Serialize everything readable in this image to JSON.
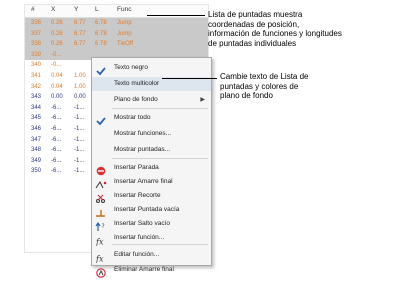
{
  "table": {
    "headers": [
      "#",
      "X",
      "Y",
      "L",
      "Func"
    ],
    "rows": [
      {
        "n": "336",
        "x": "0.26",
        "y": "6.77",
        "l": "6.78",
        "f": "Jump",
        "sel": true,
        "color": "#e07d2e"
      },
      {
        "n": "337",
        "x": "0.26",
        "y": "6.77",
        "l": "6.78",
        "f": "Jump",
        "sel": true,
        "color": "#e07d2e"
      },
      {
        "n": "338",
        "x": "0.26",
        "y": "6.77",
        "l": "6.78",
        "f": "TieOff",
        "sel": true,
        "color": "#e07d2e"
      },
      {
        "n": "339",
        "x": "-0...",
        "y": "",
        "l": "",
        "f": "",
        "sel": true,
        "color": "#e07d2e"
      },
      {
        "n": "340",
        "x": "-0...",
        "y": "",
        "l": "",
        "f": "",
        "sel": false,
        "color": "#e07d2e"
      },
      {
        "n": "341",
        "x": "0.04",
        "y": "1.00",
        "l": "",
        "f": "",
        "sel": false,
        "color": "#e07d2e"
      },
      {
        "n": "342",
        "x": "0.04",
        "y": "1.00",
        "l": "",
        "f": "",
        "sel": false,
        "color": "#e07d2e"
      },
      {
        "n": "343",
        "x": "0.00",
        "y": "0.00",
        "l": "",
        "f": "",
        "sel": false,
        "color": "#2f3b8a"
      },
      {
        "n": "344",
        "x": "-6...",
        "y": "-1...",
        "l": "",
        "f": "",
        "sel": false,
        "color": "#2f3b8a"
      },
      {
        "n": "345",
        "x": "-6...",
        "y": "-1...",
        "l": "",
        "f": "",
        "sel": false,
        "color": "#2f3b8a"
      },
      {
        "n": "346",
        "x": "-6...",
        "y": "-1...",
        "l": "",
        "f": "",
        "sel": false,
        "color": "#2f3b8a"
      },
      {
        "n": "347",
        "x": "-6...",
        "y": "-1...",
        "l": "",
        "f": "",
        "sel": false,
        "color": "#2f3b8a"
      },
      {
        "n": "348",
        "x": "-6...",
        "y": "-1...",
        "l": "",
        "f": "",
        "sel": false,
        "color": "#2f3b8a"
      },
      {
        "n": "349",
        "x": "-6...",
        "y": "-1...",
        "l": "",
        "f": "",
        "sel": false,
        "color": "#2f3b8a"
      },
      {
        "n": "350",
        "x": "-6...",
        "y": "-1...",
        "l": "",
        "f": "",
        "sel": false,
        "color": "#2f3b8a"
      }
    ]
  },
  "menu": {
    "items": [
      {
        "label": "Texto negro",
        "check": true,
        "icon": "check-icon"
      },
      {
        "label": "Texto multicolor",
        "check": false,
        "icon": "",
        "hl": true
      },
      {
        "label": "Plano de fondo",
        "submenu": true,
        "icon": ""
      },
      {
        "label": "Mostrar todo",
        "check": true,
        "icon": "check-icon"
      },
      {
        "label": "Mostrar funciones...",
        "icon": ""
      },
      {
        "label": "Mostrar puntadas...",
        "icon": ""
      },
      {
        "label": "Insertar Parada",
        "icon": "stop-icon"
      },
      {
        "label": "Insertar Amarre final",
        "icon": "tieoff-icon"
      },
      {
        "label": "Insertar Recorte",
        "icon": "trim-icon"
      },
      {
        "label": "Insertar Puntada vacía",
        "icon": "empty-stitch-icon"
      },
      {
        "label": "Insertar Salto vacío",
        "icon": "empty-jump-icon"
      },
      {
        "label": "Insertar función...",
        "icon": "function-icon"
      },
      {
        "label": "Editar función...",
        "icon": "edit-function-icon"
      },
      {
        "label": "Eliminar Amarre final",
        "icon": "delete-tieoff-icon"
      }
    ]
  },
  "callouts": {
    "top": [
      "Lista de puntadas muestra",
      "coordenadas de posición,",
      "información de funciones y longitudes",
      "de puntadas individuales"
    ],
    "middle": [
      "Cambie texto de Lista de",
      "puntadas y colores de",
      "plano de fondo"
    ]
  }
}
